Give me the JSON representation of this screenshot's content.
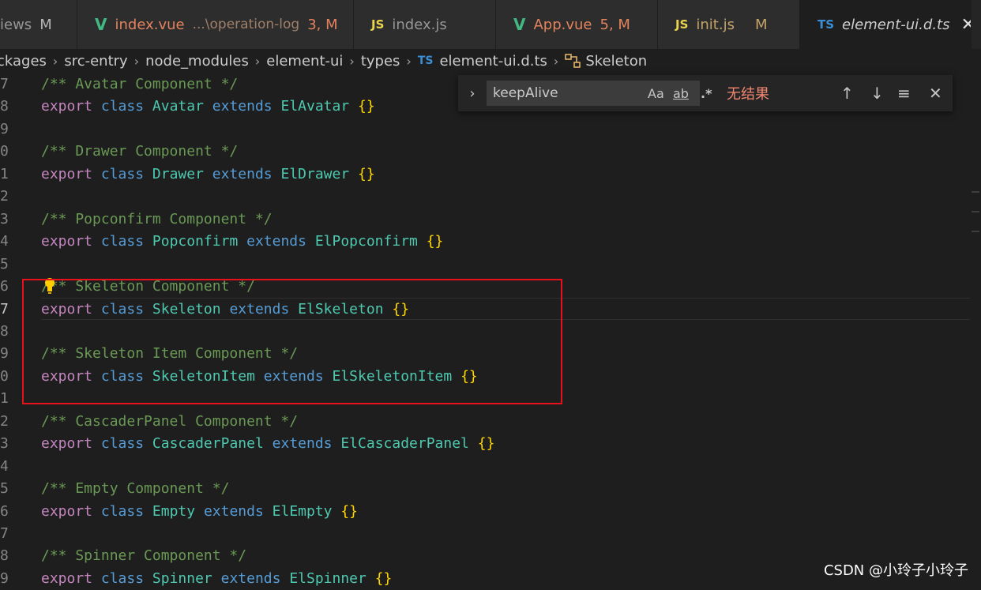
{
  "tabs": [
    {
      "icon": "",
      "name": "iews",
      "badge": "M"
    },
    {
      "icon": "V",
      "name": "index.vue",
      "sub": "...\\operation-log",
      "badge": "3, M"
    },
    {
      "icon": "JS",
      "name": "index.js",
      "badge": ""
    },
    {
      "icon": "V",
      "name": "App.vue",
      "badge": "5, M"
    },
    {
      "icon": "JS",
      "name": "init.js",
      "badge": "M"
    },
    {
      "icon": "TS",
      "name": "element-ui.d.ts",
      "close": "✕"
    }
  ],
  "breadcrumb": {
    "items": [
      "ckages",
      "src-entry",
      "node_modules",
      "element-ui",
      "types",
      "element-ui.d.ts",
      "Skeleton"
    ],
    "ts_icon": "TS"
  },
  "find": {
    "toggle": "›",
    "query": "keepAlive",
    "match_case": "Aa",
    "whole_word": "ab",
    "regex": ".*",
    "result": "无结果",
    "prev": "↑",
    "next": "↓",
    "selection": "≡",
    "close": "✕"
  },
  "lines": [
    {
      "n": "7",
      "tokens": [
        [
          "cm",
          "/** Avatar Component */"
        ]
      ]
    },
    {
      "n": "8",
      "tokens": [
        [
          "kw",
          "export"
        ],
        [
          "sp",
          " "
        ],
        [
          "st",
          "class"
        ],
        [
          "sp",
          " "
        ],
        [
          "cls",
          "Avatar"
        ],
        [
          "sp",
          " "
        ],
        [
          "st",
          "extends"
        ],
        [
          "sp",
          " "
        ],
        [
          "cls",
          "ElAvatar"
        ],
        [
          "sp",
          " "
        ],
        [
          "br",
          "{}"
        ]
      ]
    },
    {
      "n": "9",
      "tokens": []
    },
    {
      "n": "0",
      "tokens": [
        [
          "cm",
          "/** Drawer Component */"
        ]
      ]
    },
    {
      "n": "1",
      "tokens": [
        [
          "kw",
          "export"
        ],
        [
          "sp",
          " "
        ],
        [
          "st",
          "class"
        ],
        [
          "sp",
          " "
        ],
        [
          "cls",
          "Drawer"
        ],
        [
          "sp",
          " "
        ],
        [
          "st",
          "extends"
        ],
        [
          "sp",
          " "
        ],
        [
          "cls",
          "ElDrawer"
        ],
        [
          "sp",
          " "
        ],
        [
          "br",
          "{}"
        ]
      ]
    },
    {
      "n": "2",
      "tokens": []
    },
    {
      "n": "3",
      "tokens": [
        [
          "cm",
          "/** Popconfirm Component */"
        ]
      ]
    },
    {
      "n": "4",
      "tokens": [
        [
          "kw",
          "export"
        ],
        [
          "sp",
          " "
        ],
        [
          "st",
          "class"
        ],
        [
          "sp",
          " "
        ],
        [
          "cls",
          "Popconfirm"
        ],
        [
          "sp",
          " "
        ],
        [
          "st",
          "extends"
        ],
        [
          "sp",
          " "
        ],
        [
          "cls",
          "ElPopconfirm"
        ],
        [
          "sp",
          " "
        ],
        [
          "br",
          "{}"
        ]
      ]
    },
    {
      "n": "5",
      "tokens": []
    },
    {
      "n": "6",
      "tokens": [
        [
          "cm",
          "/** Skeleton Component */"
        ]
      ]
    },
    {
      "n": "7",
      "current": true,
      "tokens": [
        [
          "kw",
          "export"
        ],
        [
          "sp",
          " "
        ],
        [
          "st",
          "class"
        ],
        [
          "sp",
          " "
        ],
        [
          "cls",
          "Skeleton"
        ],
        [
          "sp",
          " "
        ],
        [
          "st",
          "extends"
        ],
        [
          "sp",
          " "
        ],
        [
          "cls",
          "ElSkeleton"
        ],
        [
          "sp",
          " "
        ],
        [
          "br",
          "{}"
        ]
      ]
    },
    {
      "n": "8",
      "tokens": []
    },
    {
      "n": "9",
      "tokens": [
        [
          "cm",
          "/** Skeleton Item Component */"
        ]
      ]
    },
    {
      "n": "0",
      "tokens": [
        [
          "kw",
          "export"
        ],
        [
          "sp",
          " "
        ],
        [
          "st",
          "class"
        ],
        [
          "sp",
          " "
        ],
        [
          "cls",
          "SkeletonItem"
        ],
        [
          "sp",
          " "
        ],
        [
          "st",
          "extends"
        ],
        [
          "sp",
          " "
        ],
        [
          "cls",
          "ElSkeletonItem"
        ],
        [
          "sp",
          " "
        ],
        [
          "br",
          "{}"
        ]
      ]
    },
    {
      "n": "1",
      "tokens": []
    },
    {
      "n": "2",
      "tokens": [
        [
          "cm",
          "/** CascaderPanel Component */"
        ]
      ]
    },
    {
      "n": "3",
      "tokens": [
        [
          "kw",
          "export"
        ],
        [
          "sp",
          " "
        ],
        [
          "st",
          "class"
        ],
        [
          "sp",
          " "
        ],
        [
          "cls",
          "CascaderPanel"
        ],
        [
          "sp",
          " "
        ],
        [
          "st",
          "extends"
        ],
        [
          "sp",
          " "
        ],
        [
          "cls",
          "ElCascaderPanel"
        ],
        [
          "sp",
          " "
        ],
        [
          "br",
          "{}"
        ]
      ]
    },
    {
      "n": "4",
      "tokens": []
    },
    {
      "n": "5",
      "tokens": [
        [
          "cm",
          "/** Empty Component */"
        ]
      ]
    },
    {
      "n": "6",
      "tokens": [
        [
          "kw",
          "export"
        ],
        [
          "sp",
          " "
        ],
        [
          "st",
          "class"
        ],
        [
          "sp",
          " "
        ],
        [
          "cls",
          "Empty"
        ],
        [
          "sp",
          " "
        ],
        [
          "st",
          "extends"
        ],
        [
          "sp",
          " "
        ],
        [
          "cls",
          "ElEmpty"
        ],
        [
          "sp",
          " "
        ],
        [
          "br",
          "{}"
        ]
      ]
    },
    {
      "n": "7",
      "tokens": []
    },
    {
      "n": "8",
      "tokens": [
        [
          "cm",
          "/** Spinner Component */"
        ]
      ]
    },
    {
      "n": "9",
      "tokens": [
        [
          "kw",
          "export"
        ],
        [
          "sp",
          " "
        ],
        [
          "st",
          "class"
        ],
        [
          "sp",
          " "
        ],
        [
          "cls",
          "Spinner"
        ],
        [
          "sp",
          " "
        ],
        [
          "st",
          "extends"
        ],
        [
          "sp",
          " "
        ],
        [
          "cls",
          "ElSpinner"
        ],
        [
          "sp",
          " "
        ],
        [
          "br",
          "{}"
        ]
      ]
    }
  ],
  "watermark": "CSDN @小玲子小玲子",
  "colors": {
    "editor_bg": "#1e1e1e",
    "comment": "#6a9955",
    "keyword_export": "#c586c0",
    "keyword": "#569cd6",
    "class_name": "#4ec9b0",
    "bracket": "#ffd700",
    "highlight_box": "#e8101a",
    "find_no_result": "#f48771"
  }
}
